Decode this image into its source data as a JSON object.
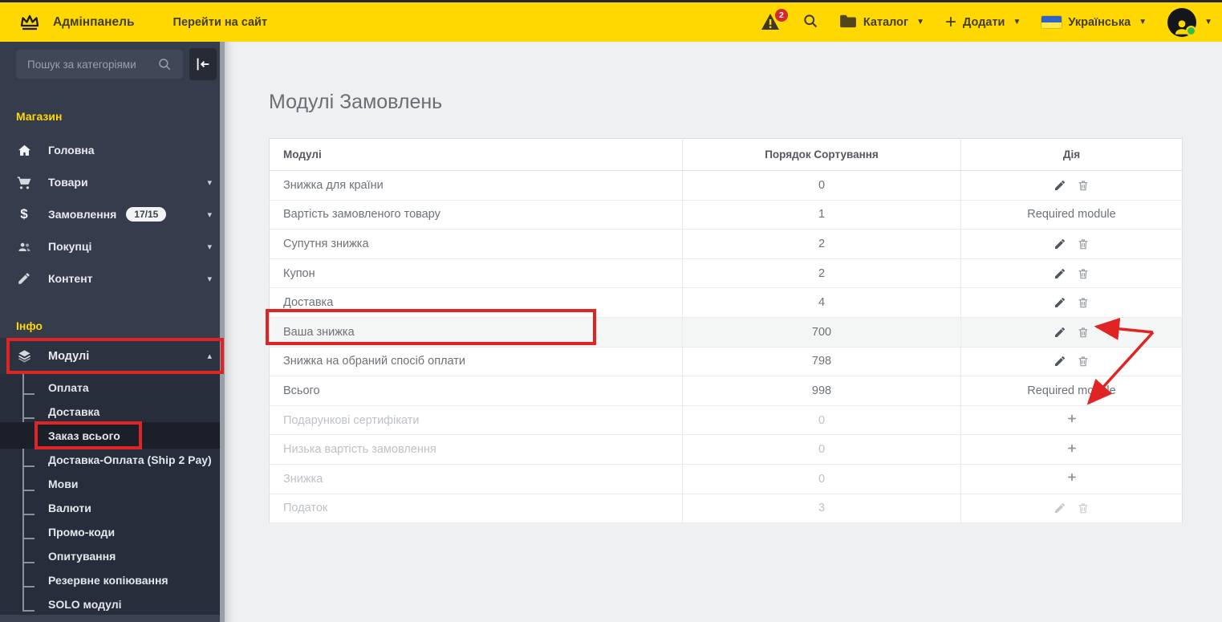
{
  "colors": {
    "accent": "#ffd701",
    "annotation": "#e02423",
    "sidebar": "#353d4c"
  },
  "topbar": {
    "brand": "Адмінпанель",
    "goto_site": "Перейти на сайт",
    "alerts_count": "2",
    "catalog_label": "Каталог",
    "add_label": "Додати",
    "language_label": "Українська"
  },
  "sidebar": {
    "search_placeholder": "Пошук за категоріями",
    "sections": [
      {
        "header": "Магазин",
        "items": [
          {
            "label": "Головна",
            "icon": "home-icon"
          },
          {
            "label": "Товари",
            "icon": "cart-icon",
            "chevron": "down"
          },
          {
            "label": "Замовлення",
            "icon": "dollar-icon",
            "badge": "17/15",
            "chevron": "down"
          },
          {
            "label": "Покупці",
            "icon": "customers-icon",
            "chevron": "down"
          },
          {
            "label": "Контент",
            "icon": "content-icon",
            "chevron": "down"
          }
        ]
      },
      {
        "header": "Інфо",
        "items": [
          {
            "label": "Модулі",
            "icon": "layers-icon",
            "chevron": "up",
            "expanded": true,
            "children": [
              "Оплата",
              "Доставка",
              "Заказ всього",
              "Доставка-Оплата (Ship 2 Pay)",
              "Мови",
              "Валюти",
              "Промо-коди",
              "Опитування",
              "Резервне копіювання",
              "SOLO модулі"
            ],
            "active_index": 2
          }
        ]
      }
    ]
  },
  "main": {
    "title": "Модулі Замовлень",
    "table": {
      "columns": [
        "Модулі",
        "Порядок Сортування",
        "Дія"
      ],
      "rows": [
        {
          "name": "Знижка для країни",
          "sort": "0",
          "action": "edit-delete"
        },
        {
          "name": "Вартість замовленого товару",
          "sort": "1",
          "action": "required",
          "action_label": "Required module"
        },
        {
          "name": "Супутня знижка",
          "sort": "2",
          "action": "edit-delete"
        },
        {
          "name": "Купон",
          "sort": "2",
          "action": "edit-delete"
        },
        {
          "name": "Доставка",
          "sort": "4",
          "action": "edit-delete"
        },
        {
          "name": "Ваша знижка",
          "sort": "700",
          "action": "edit-delete",
          "highlight": true
        },
        {
          "name": "Знижка на обраний спосіб оплати",
          "sort": "798",
          "action": "edit-delete"
        },
        {
          "name": "Всього",
          "sort": "998",
          "action": "required",
          "action_label": "Required module"
        },
        {
          "name": "Подарункові сертифікати",
          "sort": "0",
          "action": "add",
          "muted": true
        },
        {
          "name": "Низька вартість замовлення",
          "sort": "0",
          "action": "add",
          "muted": true
        },
        {
          "name": "Знижка",
          "sort": "0",
          "action": "add",
          "muted": true
        },
        {
          "name": "Податок",
          "sort": "3",
          "action": "edit-delete",
          "muted": true
        }
      ]
    }
  }
}
